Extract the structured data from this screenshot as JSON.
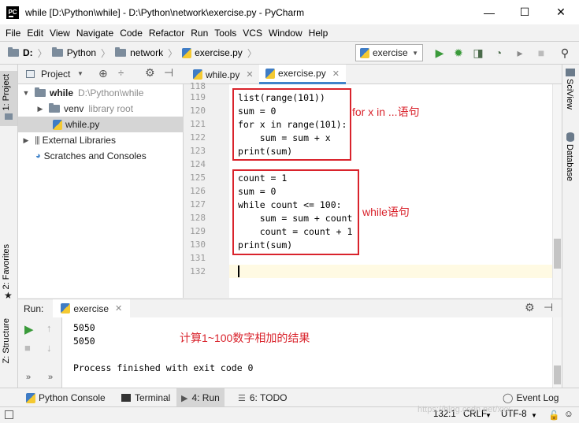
{
  "window": {
    "app_icon_text": "PC",
    "title": "while [D:\\Python\\while] - D:\\Python\\network\\exercise.py - PyCharm",
    "controls": [
      "—",
      "☐",
      "✕"
    ]
  },
  "menu": [
    "File",
    "Edit",
    "View",
    "Navigate",
    "Code",
    "Refactor",
    "Run",
    "Tools",
    "VCS",
    "Window",
    "Help"
  ],
  "navbar": {
    "drive": "D:",
    "crumbs": [
      "Python",
      "network"
    ],
    "file": "exercise.py",
    "run_config": "exercise"
  },
  "left_strip": {
    "project_tab": "1: Project",
    "favorites_tab": "2: Favorites",
    "structure_tab": "Z: Structure"
  },
  "project": {
    "header": "Project",
    "tree": [
      {
        "label": "while",
        "note": "D:\\Python\\while"
      },
      {
        "label": "venv",
        "note": "library root"
      },
      {
        "label": "while.py",
        "note": ""
      },
      {
        "label": "External Libraries",
        "note": ""
      },
      {
        "label": "Scratches and Consoles",
        "note": ""
      }
    ]
  },
  "editor": {
    "tabs": [
      {
        "label": "while.py"
      },
      {
        "label": "exercise.py"
      }
    ],
    "line_numbers": [
      "118",
      "119",
      "120",
      "121",
      "122",
      "123",
      "124",
      "125",
      "126",
      "127",
      "128",
      "129",
      "130",
      "131",
      "132"
    ],
    "code": [
      "",
      "list(range(101))",
      "sum = 0",
      "for x in range(101):",
      "    sum = sum + x",
      "print(sum)",
      "",
      "count = 1",
      "sum = 0",
      "while count <= 100:",
      "    sum = sum + count",
      "    count = count + 1",
      "print(sum)",
      "",
      ""
    ],
    "annotations": {
      "for_note": "for x in ...语句",
      "while_note": "while语句",
      "result_note": "计算1~100数字相加的结果"
    }
  },
  "right_strip": {
    "sciview_tab": "SciView",
    "database_tab": "Database"
  },
  "run_panel": {
    "label": "Run:",
    "tab": "exercise",
    "output": [
      "5050",
      "5050",
      "",
      "Process finished with exit code 0"
    ]
  },
  "bottom_tabs": [
    {
      "label": "Python Console"
    },
    {
      "label": "Terminal"
    },
    {
      "label": "4: Run"
    },
    {
      "label": "6: TODO"
    },
    {
      "label": "Event Log"
    }
  ],
  "status": {
    "position": "132:1",
    "line_sep": "CRLF",
    "encoding": "UTF-8",
    "watermark": "https://blog.csdn.net/xxx"
  },
  "colors": {
    "accent": "#4083c9",
    "annotation_red": "#d9232c",
    "run_green": "#3a9a3a"
  }
}
